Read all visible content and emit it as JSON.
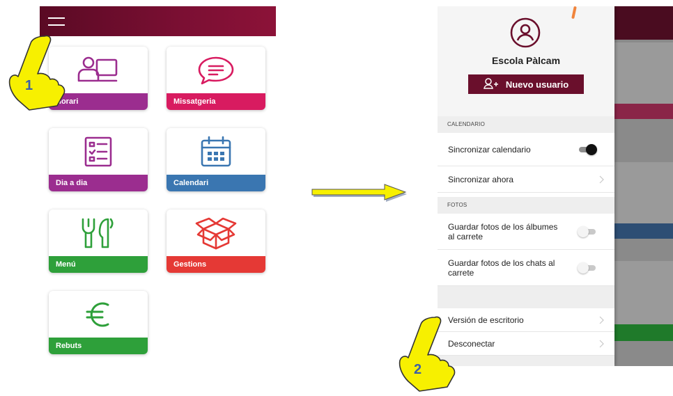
{
  "left_phone": {
    "tiles": [
      {
        "label": "Horari",
        "icon": "teacher-board-icon",
        "color": "#9b2d8f"
      },
      {
        "label": "Missatgeria",
        "icon": "chat-bubble-icon",
        "color": "#d81b60"
      },
      {
        "label": "Dia a dia",
        "icon": "checklist-icon",
        "color": "#9b2d8f"
      },
      {
        "label": "Calendari",
        "icon": "calendar-icon",
        "color": "#3a76b1"
      },
      {
        "label": "Menú",
        "icon": "fork-knife-icon",
        "color": "#2ea03a"
      },
      {
        "label": "Gestions",
        "icon": "open-box-icon",
        "color": "#e53935"
      },
      {
        "label": "Rebuts",
        "icon": "euro-icon",
        "color": "#2ea03a"
      }
    ]
  },
  "drawer": {
    "school_name": "Escola Pàlcam",
    "new_user_label": "Nuevo usuario",
    "sections": {
      "calendar_header": "CALENDARIO",
      "photos_header": "FOTOS"
    },
    "rows": {
      "sync_calendar": "Sincronizar calendario",
      "sync_now": "Sincronizar ahora",
      "save_album_photos": "Guardar fotos de los álbumes al carrete",
      "save_chat_photos": "Guardar fotos de los chats al carrete",
      "desktop_version": "Versión de escritorio",
      "disconnect": "Desconectar"
    },
    "toggles": {
      "sync_calendar": true,
      "save_album_photos": false,
      "save_chat_photos": false
    }
  },
  "callouts": {
    "step1": "1",
    "step2": "2"
  },
  "colors": {
    "brand": "#7b0f33",
    "callout_hand": "#f7f000",
    "callout_number": "#3b5fa8"
  }
}
